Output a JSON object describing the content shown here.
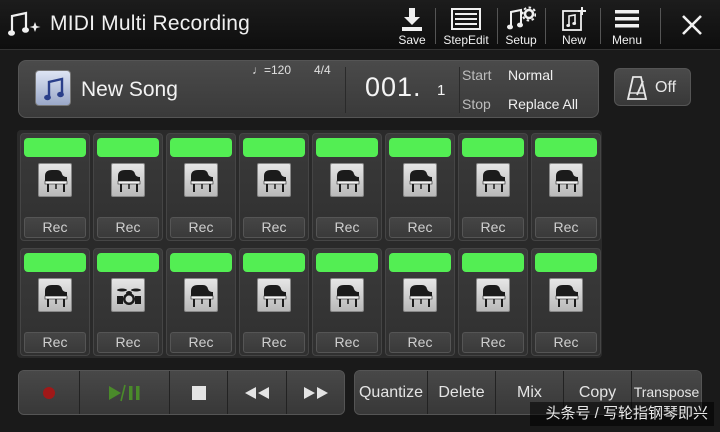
{
  "app": {
    "title": "MIDI Multi Recording"
  },
  "toolbar": {
    "save_label": "Save",
    "stepedit_label": "StepEdit",
    "setup_label": "Setup",
    "new_label": "New",
    "menu_label": "Menu"
  },
  "song": {
    "name": "New Song",
    "tempo": "♩=120",
    "time_signature": "4/4",
    "measure": "001.",
    "beat": "1",
    "start_label": "Start",
    "start_value": "Normal",
    "stop_label": "Stop",
    "stop_value": "Replace All"
  },
  "metronome": {
    "label": "Off"
  },
  "channels": [
    {
      "voice_icon": "grand-piano-icon",
      "rec_label": "Rec"
    },
    {
      "voice_icon": "grand-piano-icon",
      "rec_label": "Rec"
    },
    {
      "voice_icon": "grand-piano-icon",
      "rec_label": "Rec"
    },
    {
      "voice_icon": "grand-piano-icon",
      "rec_label": "Rec"
    },
    {
      "voice_icon": "grand-piano-icon",
      "rec_label": "Rec"
    },
    {
      "voice_icon": "grand-piano-icon",
      "rec_label": "Rec"
    },
    {
      "voice_icon": "grand-piano-icon",
      "rec_label": "Rec"
    },
    {
      "voice_icon": "grand-piano-icon",
      "rec_label": "Rec"
    },
    {
      "voice_icon": "grand-piano-icon",
      "rec_label": "Rec"
    },
    {
      "voice_icon": "drum-kit-icon",
      "rec_label": "Rec"
    },
    {
      "voice_icon": "grand-piano-icon",
      "rec_label": "Rec"
    },
    {
      "voice_icon": "grand-piano-icon",
      "rec_label": "Rec"
    },
    {
      "voice_icon": "grand-piano-icon",
      "rec_label": "Rec"
    },
    {
      "voice_icon": "grand-piano-icon",
      "rec_label": "Rec"
    },
    {
      "voice_icon": "grand-piano-icon",
      "rec_label": "Rec"
    },
    {
      "voice_icon": "grand-piano-icon",
      "rec_label": "Rec"
    }
  ],
  "edit": {
    "quantize": "Quantize",
    "delete": "Delete",
    "mix": "Mix",
    "copy": "Copy",
    "transpose": "Transpose"
  },
  "watermark": "头条号 / 写轮指钢琴即兴",
  "colors": {
    "channel_on": "#53ee53",
    "record": "#a01818",
    "play": "#4a8a2a"
  }
}
